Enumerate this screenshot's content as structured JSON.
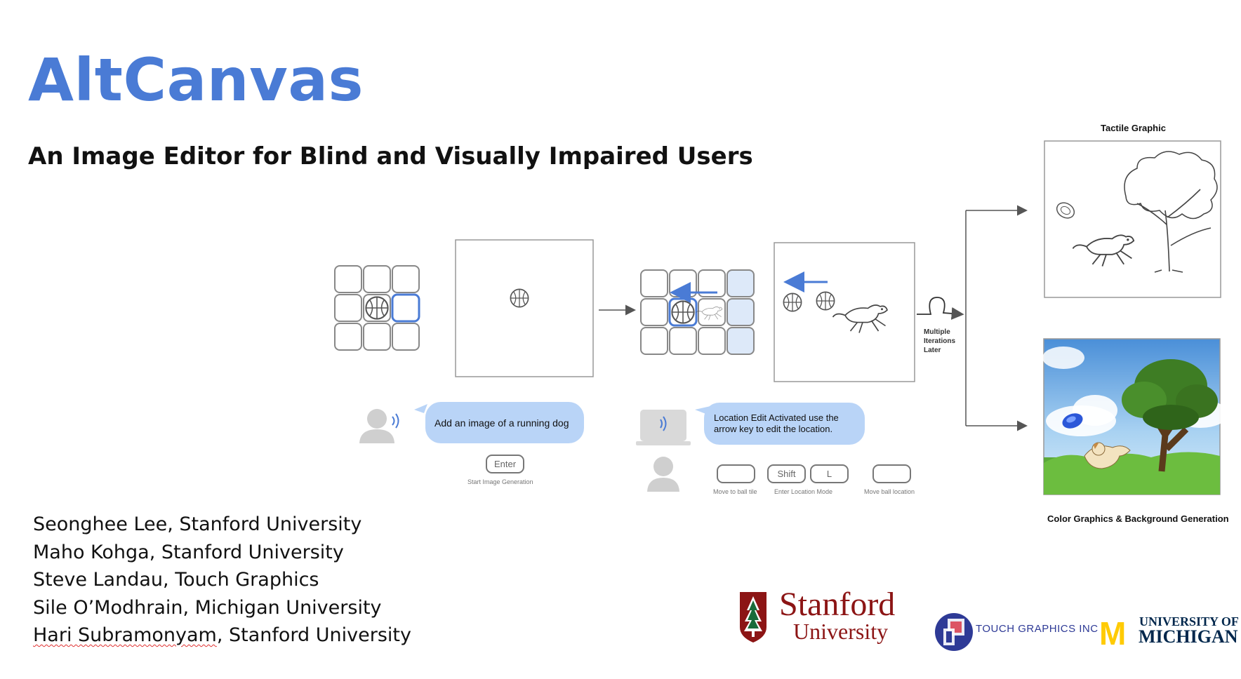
{
  "slide": {
    "title": "AltCanvas",
    "subtitle": "An Image Editor for Blind and Visually Impaired Users"
  },
  "authors": [
    {
      "name": "Seonghee Lee",
      "affiliation": "Stanford University"
    },
    {
      "name": "Maho Kohga",
      "affiliation": "Stanford University"
    },
    {
      "name": "Steve Landau",
      "affiliation": "Touch Graphics"
    },
    {
      "name": "Sile O’Modhrain",
      "affiliation": "Michigan University"
    },
    {
      "name": "Hari Subramonyam",
      "affiliation": "Stanford University"
    }
  ],
  "figure": {
    "bubble_user": "Add an image of a running dog",
    "bubble_system_line1": "Location Edit Activated use the",
    "bubble_system_line2": "arrow key to edit the location.",
    "key_enter": "Enter",
    "caption_enter": "Start Image Generation",
    "key_shift": "Shift",
    "key_l": "L",
    "caption_move_tile": "Move to ball tile",
    "caption_location_mode": "Enter Location Mode",
    "caption_move_ball": "Move ball location",
    "iterations_line1": "Multiple",
    "iterations_line2": "Iterations",
    "iterations_line3": "Later",
    "tactile_label": "Tactile Graphic",
    "color_label": "Color Graphics & Background Generation"
  },
  "logos": {
    "stanford_line1": "Stanford",
    "stanford_line2": "University",
    "touch_graphics": "TOUCH GRAPHICS INC",
    "michigan_line1": "UNIVERSITY OF",
    "michigan_line2": "MICHIGAN",
    "michigan_mark": "M"
  },
  "colors": {
    "title": "#4a7bd5",
    "accent_blue": "#4a7bd5",
    "bubble": "#b9d4f7",
    "stanford_red": "#8c1515",
    "michigan_maize": "#ffcb05",
    "michigan_blue": "#00274c"
  }
}
